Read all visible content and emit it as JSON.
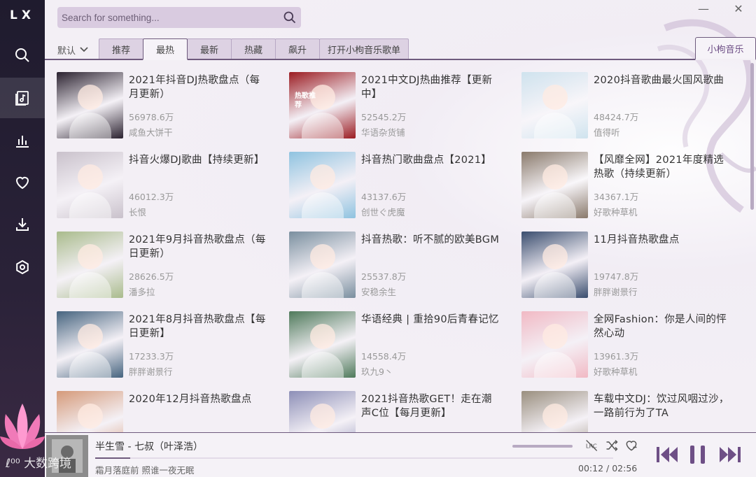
{
  "app": {
    "logo": "LX"
  },
  "search": {
    "placeholder": "Search for something..."
  },
  "window": {
    "minimize": "—",
    "close": "✕"
  },
  "tabs": {
    "sort_label": "默认",
    "items": [
      "推荐",
      "最热",
      "最新",
      "热藏",
      "飙升",
      "打开小枸音乐歌单"
    ],
    "active_index": 1,
    "source": "小枸音乐"
  },
  "playlists": [
    {
      "title": "2021年抖音DJ热歌盘点（每月更新）",
      "count": "56978.6万",
      "author": "咸鱼大饼干",
      "cover_color": "#2b2230"
    },
    {
      "title": "2021中文DJ热曲推荐【更新中】",
      "count": "52545.2万",
      "author": "华语杂货铺",
      "cover_color": "#9b1c22",
      "cover_text": "热歌推荐"
    },
    {
      "title": "2020抖音歌曲最火国风歌曲",
      "count": "48424.7万",
      "author": "值得听",
      "cover_color": "#cfe3ee"
    },
    {
      "title": "抖音火爆DJ歌曲【持续更新】",
      "count": "46012.3万",
      "author": "长恨",
      "cover_color": "#c9c1cb"
    },
    {
      "title": "抖音热门歌曲盘点【2021】",
      "count": "43137.6万",
      "author": "创世ぐ虎魔",
      "cover_color": "#8fc3e0"
    },
    {
      "title": "【风靡全网】2021年度精选热歌（持续更新）",
      "count": "34367.1万",
      "author": "好歌种草机",
      "cover_color": "#8a7a6c"
    },
    {
      "title": "2021年9月抖音热歌盘点（每日更新）",
      "count": "28626.5万",
      "author": "潘多拉",
      "cover_color": "#a9bb8c"
    },
    {
      "title": "抖音热歌：听不腻的欧美BGM",
      "count": "25537.8万",
      "author": "安稳余生",
      "cover_color": "#7a8f9f"
    },
    {
      "title": "11月抖音热歌盘点",
      "count": "19747.8万",
      "author": "胖胖谢景行",
      "cover_color": "#3a4d6e"
    },
    {
      "title": "2021年8月抖音热歌盘点【每日更新】",
      "count": "17233.3万",
      "author": "胖胖谢景行",
      "cover_color": "#46647f"
    },
    {
      "title": "华语经典 | 重拾90后青春记忆",
      "count": "14558.4万",
      "author": "玖九9丶",
      "cover_color": "#4f7a5b"
    },
    {
      "title": "全网Fashion：你是人间的怦然心动",
      "count": "13961.3万",
      "author": "好歌种草机",
      "cover_color": "#f1b9c4"
    },
    {
      "title": "2020年12月抖音热歌盘点",
      "count": "",
      "author": "",
      "cover_color": "#d59a7a"
    },
    {
      "title": "2021抖音热歌GET！走在潮声C位【每月更新】",
      "count": "",
      "author": "",
      "cover_color": "#8d8fb7"
    },
    {
      "title": "车载中文DJ：饮过风咽过沙，一路前行为了TA",
      "count": "",
      "author": "",
      "cover_color": "#9a8f7f"
    }
  ],
  "player": {
    "song": "半生雪 - 七叔（叶泽浩）",
    "lyric": "霜月落庭前 照谁一夜无眠",
    "current_time": "00:12",
    "separator": "/",
    "total_time": "02:56",
    "progress": 0.068
  },
  "watermark": "大数跨境"
}
